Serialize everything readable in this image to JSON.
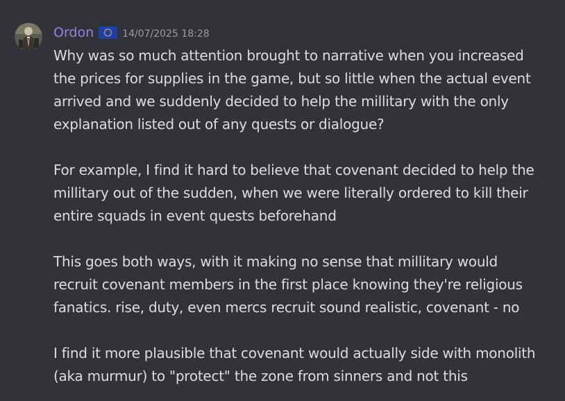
{
  "message": {
    "author": "Ordon",
    "flag_icon": "eu-flag-icon",
    "timestamp": "14/07/2025 18:28",
    "paragraphs": [
      [
        "Why was so much attention brought to narrative when you increased",
        "the prices for supplies in the game, but so little when the actual event",
        "arrived and we suddenly decided to help the millitary with the only",
        "explanation listed out of any quests or dialogue?"
      ],
      [
        "For example, I find it hard to believe that covenant decided to help the",
        "millitary out of the sudden, when we were literally ordered to kill their",
        "entire squads in event quests beforehand"
      ],
      [
        "This goes both ways, with it making no sense that millitary would",
        "recruit covenant members in the first place knowing they're religious",
        "fanatics. rise, duty, even mercs recruit sound realistic, covenant - no"
      ],
      [
        "I find it more plausible that covenant would actually side with monolith",
        "(aka murmur) to \"protect\" the zone from sinners and not this"
      ]
    ]
  },
  "colors": {
    "background": "#323339",
    "username": "#8e86e6",
    "text": "#dbdee1",
    "timestamp": "#9a9ca3"
  }
}
